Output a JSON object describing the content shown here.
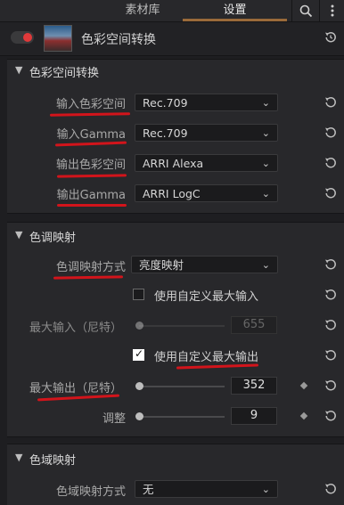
{
  "tabs": [
    {
      "label": "素材库"
    },
    {
      "label": "设置"
    }
  ],
  "effect": {
    "title": "色彩空间转换",
    "enabled": true
  },
  "sections": {
    "csc": {
      "title": "色彩空间转换",
      "rows": [
        {
          "label": "输入色彩空间",
          "value": "Rec.709"
        },
        {
          "label": "输入Gamma",
          "value": "Rec.709"
        },
        {
          "label": "输出色彩空间",
          "value": "ARRI Alexa"
        },
        {
          "label": "输出Gamma",
          "value": "ARRI LogC"
        }
      ]
    },
    "tone": {
      "title": "色调映射",
      "method_label": "色调映射方式",
      "method_value": "亮度映射",
      "custom_max_input_label": "使用自定义最大输入",
      "custom_max_input_checked": false,
      "max_input_label": "最大输入（尼特）",
      "max_input_value": "655",
      "custom_max_output_label": "使用自定义最大输出",
      "custom_max_output_checked": true,
      "max_output_label": "最大输出（尼特）",
      "max_output_value": "352",
      "adjust_label": "调整",
      "adjust_value": "9"
    },
    "gamut": {
      "title": "色域映射",
      "method_label": "色域映射方式",
      "method_value": "无"
    }
  },
  "colors": {
    "accent": "#9a6a3a",
    "annotation_red": "#d2141b",
    "toggle_on": "#e0393a"
  },
  "icons": [
    "search-icon",
    "more-vertical-icon",
    "reset-icon",
    "chevron-down-icon",
    "keyframe-diamond-icon",
    "checkmark-icon"
  ]
}
